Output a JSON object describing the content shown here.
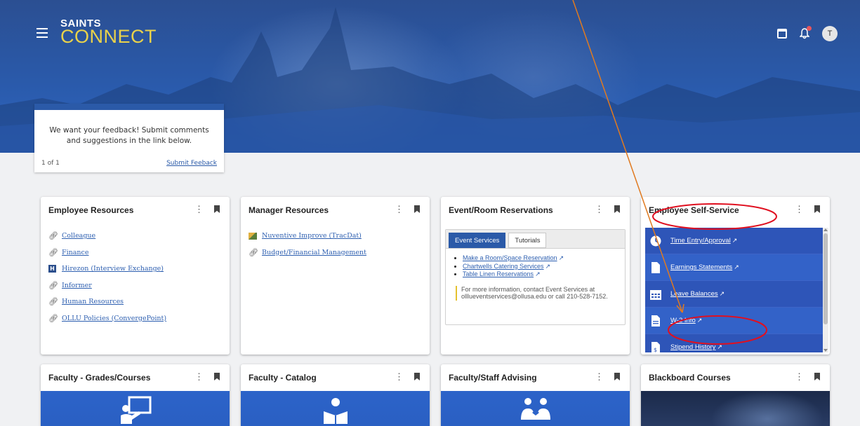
{
  "brand": {
    "line1": "SAINTS",
    "line2": "CONNECT"
  },
  "header": {
    "avatar_initial": "T"
  },
  "feedback": {
    "message": "We want your feedback! Submit comments and suggestions in the link below.",
    "pager": "1 of 1",
    "link": "Submit Feeback"
  },
  "cards": {
    "employee_resources": {
      "title": "Employee Resources",
      "links": [
        "Colleague",
        "Finance",
        "Hirezon (Interview Exchange)",
        "Informer",
        "Human Resources",
        "OLLU Policies (ConvergePoint)"
      ]
    },
    "manager_resources": {
      "title": "Manager Resources",
      "links": [
        "Nuventive Improve (TracDat)",
        "Budget/Financial Management"
      ]
    },
    "event_reservations": {
      "title": "Event/Room Reservations",
      "tabs": [
        "Event Services",
        "Tutorials"
      ],
      "links": [
        "Make a Room/Space Reservation",
        "Chartwells Catering Services",
        "Table Linen Reservations"
      ],
      "info": "For more information, contact Event Services at olllueventservices@ollusa.edu or call 210-528-7152."
    },
    "employee_self_service": {
      "title": "Employee Self-Service",
      "items": [
        "Time Entry/Approval",
        "Earnings Statements",
        "Leave Balances",
        "W-2 Info",
        "Stipend History"
      ]
    },
    "faculty_grades": {
      "title": "Faculty - Grades/Courses"
    },
    "faculty_catalog": {
      "title": "Faculty - Catalog"
    },
    "advising": {
      "title": "Faculty/Staff Advising"
    },
    "blackboard": {
      "title": "Blackboard Courses"
    }
  },
  "colors": {
    "primary_blue": "#2b5aa8",
    "tile_blue": "#2e55b8",
    "brand_yellow": "#e9d24a",
    "annotation_red": "#e01020",
    "annotation_orange": "#e07a20"
  }
}
